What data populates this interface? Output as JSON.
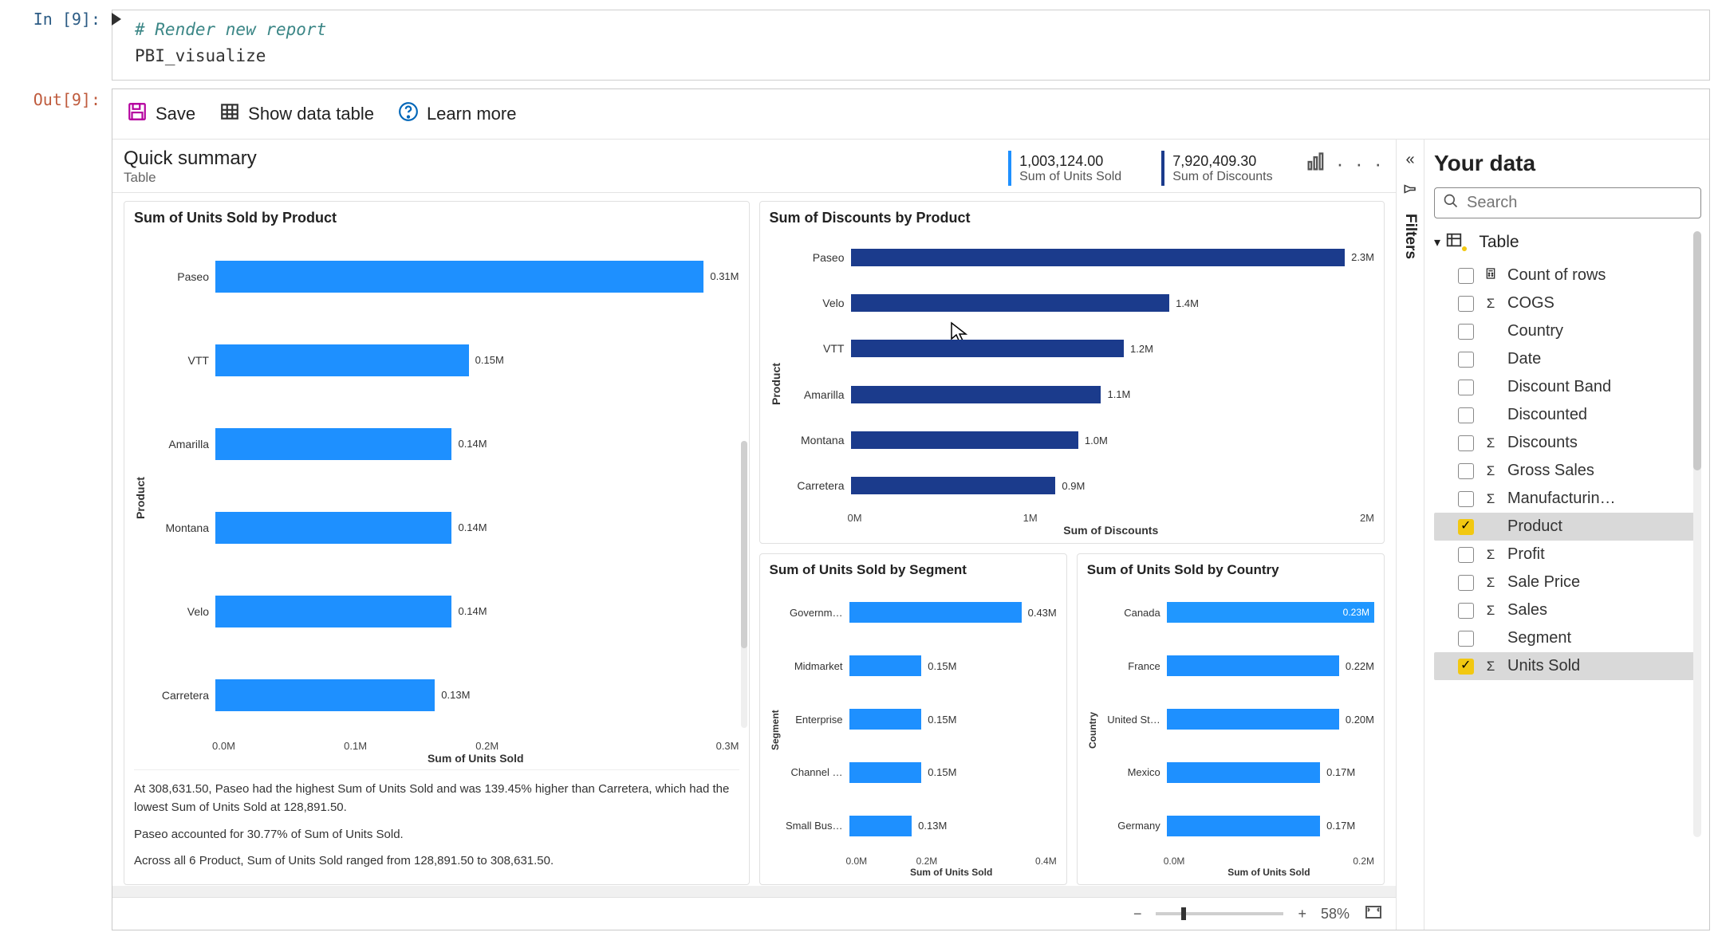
{
  "notebook": {
    "in_prompt": "In [9]:",
    "out_prompt": "Out[9]:",
    "code_comment": "# Render new report",
    "code_line": "PBI_visualize"
  },
  "toolbar": {
    "save_label": "Save",
    "show_table_label": "Show data table",
    "learn_more_label": "Learn more"
  },
  "header": {
    "title": "Quick summary",
    "subtitle": "Table",
    "kpi1_value": "1,003,124.00",
    "kpi1_label": "Sum of Units Sold",
    "kpi2_value": "7,920,409.30",
    "kpi2_label": "Sum of Discounts"
  },
  "chart_data": [
    {
      "id": "units_by_product",
      "type": "bar",
      "orientation": "horizontal",
      "title": "Sum of Units Sold by Product",
      "ylabel": "Product",
      "xlabel": "Sum of Units Sold",
      "categories": [
        "Paseo",
        "VTT",
        "Amarilla",
        "Montana",
        "Velo",
        "Carretera"
      ],
      "values_label": [
        "0.31M",
        "0.15M",
        "0.14M",
        "0.14M",
        "0.14M",
        "0.13M"
      ],
      "values": [
        0.31,
        0.15,
        0.14,
        0.14,
        0.14,
        0.13
      ],
      "xticks": [
        "0.0M",
        "0.1M",
        "0.2M",
        "0.3M"
      ],
      "color": "#1e90ff",
      "notes": [
        "At 308,631.50,  Paseo had the highest Sum of Units Sold and was 139.45% higher than  Carretera, which had the lowest Sum of Units Sold at 128,891.50.",
        " Paseo accounted for 30.77% of Sum of Units Sold.",
        "Across all 6 Product, Sum of Units Sold ranged from 128,891.50 to 308,631.50."
      ]
    },
    {
      "id": "discounts_by_product",
      "type": "bar",
      "orientation": "horizontal",
      "title": "Sum of Discounts by Product",
      "ylabel": "Product",
      "xlabel": "Sum of Discounts",
      "categories": [
        "Paseo",
        "Velo",
        "VTT",
        "Amarilla",
        "Montana",
        "Carretera"
      ],
      "values_label": [
        "2.3M",
        "1.4M",
        "1.2M",
        "1.1M",
        "1.0M",
        "0.9M"
      ],
      "values": [
        2.3,
        1.4,
        1.2,
        1.1,
        1.0,
        0.9
      ],
      "xticks": [
        "0M",
        "1M",
        "2M"
      ],
      "color": "#1b3b8c"
    },
    {
      "id": "units_by_segment",
      "type": "bar",
      "orientation": "horizontal",
      "title": "Sum of Units Sold by Segment",
      "ylabel": "Segment",
      "xlabel": "Sum of Units Sold",
      "categories": [
        "Governm…",
        "Midmarket",
        "Enterprise",
        "Channel …",
        "Small Bus…"
      ],
      "values_label": [
        "0.43M",
        "0.15M",
        "0.15M",
        "0.15M",
        "0.13M"
      ],
      "values": [
        0.43,
        0.15,
        0.15,
        0.15,
        0.13
      ],
      "xticks": [
        "0.0M",
        "0.2M",
        "0.4M"
      ],
      "color": "#1e90ff"
    },
    {
      "id": "units_by_country",
      "type": "bar",
      "orientation": "horizontal",
      "title": "Sum of Units Sold by Country",
      "ylabel": "Country",
      "xlabel": "Sum of Units Sold",
      "categories": [
        "Canada",
        "France",
        "United St…",
        "Mexico",
        "Germany"
      ],
      "values_label": [
        "0.23M",
        "0.22M",
        "0.20M",
        "0.17M",
        "0.17M"
      ],
      "values": [
        0.23,
        0.22,
        0.2,
        0.17,
        0.17
      ],
      "xticks": [
        "0.0M",
        "0.2M"
      ],
      "color": "#1e90ff",
      "highlighted": "Canada"
    }
  ],
  "filters": {
    "label": "Filters"
  },
  "data_panel": {
    "title": "Your data",
    "search_placeholder": "Search",
    "table_label": "Table",
    "fields": [
      {
        "name": "Count of rows",
        "icon": "calc",
        "selected": false
      },
      {
        "name": "COGS",
        "icon": "sigma",
        "selected": false
      },
      {
        "name": "Country",
        "icon": "",
        "selected": false
      },
      {
        "name": "Date",
        "icon": "",
        "selected": false
      },
      {
        "name": "Discount Band",
        "icon": "",
        "selected": false
      },
      {
        "name": "Discounted",
        "icon": "",
        "selected": false
      },
      {
        "name": "Discounts",
        "icon": "sigma",
        "selected": false
      },
      {
        "name": "Gross Sales",
        "icon": "sigma",
        "selected": false
      },
      {
        "name": "Manufacturin…",
        "icon": "sigma",
        "selected": false
      },
      {
        "name": "Product",
        "icon": "",
        "selected": true
      },
      {
        "name": "Profit",
        "icon": "sigma",
        "selected": false
      },
      {
        "name": "Sale Price",
        "icon": "sigma",
        "selected": false
      },
      {
        "name": "Sales",
        "icon": "sigma",
        "selected": false
      },
      {
        "name": "Segment",
        "icon": "",
        "selected": false
      },
      {
        "name": "Units Sold",
        "icon": "sigma",
        "selected": true
      }
    ]
  },
  "zoom": {
    "minus": "−",
    "plus": "+",
    "value": "58%"
  }
}
